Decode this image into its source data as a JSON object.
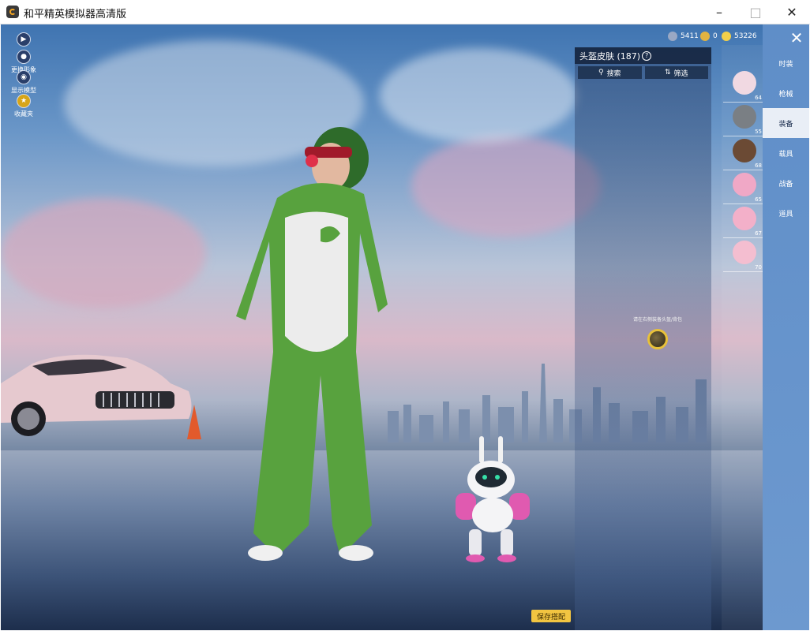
{
  "window": {
    "title": "和平精英模拟器高清版"
  },
  "left_tools": [
    {
      "label": "",
      "icon": "play-icon"
    },
    {
      "label": "更换形象",
      "icon": "person-icon"
    },
    {
      "label": "显示模型",
      "icon": "eye-icon"
    },
    {
      "label": "收藏夹",
      "icon": "star-icon"
    }
  ],
  "currency": [
    {
      "value": "5411",
      "icon": "gem-icon",
      "color": "#9aa8c4"
    },
    {
      "value": "0",
      "icon": "medal-icon",
      "color": "#e2b340"
    },
    {
      "value": "53226",
      "icon": "coin-icon",
      "color": "#f2cf4a"
    }
  ],
  "skin_panel": {
    "title": "头盔皮肤 (187)",
    "search_label": "搜索",
    "filter_label": "筛选",
    "hint": "请在右侧装备头盔/背包"
  },
  "items": [
    {
      "count": "64",
      "name": "rabbit-helmet"
    },
    {
      "count": "55",
      "name": "military-helmet"
    },
    {
      "count": "68",
      "name": "brown-helmet"
    },
    {
      "count": "65",
      "name": "pink-bear-helmet"
    },
    {
      "count": "67",
      "name": "pink-bear-helmet-2"
    },
    {
      "count": "70",
      "name": "pink-pig-helmet"
    }
  ],
  "tabs": [
    {
      "label": "时装",
      "active": false
    },
    {
      "label": "枪械",
      "active": false
    },
    {
      "label": "装备",
      "active": true
    },
    {
      "label": "载具",
      "active": false
    },
    {
      "label": "战备",
      "active": false
    },
    {
      "label": "道具",
      "active": false
    }
  ],
  "save_label": "保存搭配"
}
